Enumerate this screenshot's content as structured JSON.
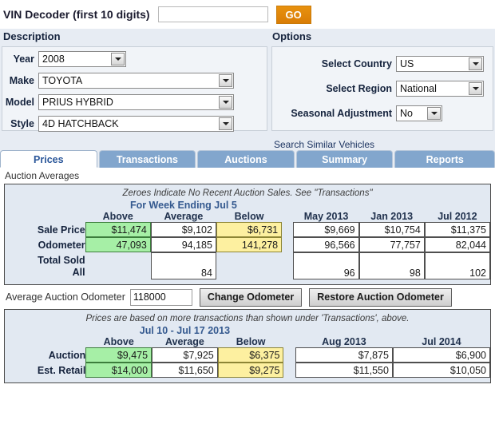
{
  "vin": {
    "label": "VIN Decoder (first 10 digits)",
    "value": "",
    "placeholder": "",
    "go_label": "GO"
  },
  "sections": {
    "description_header": "Description",
    "options_header": "Options"
  },
  "description": {
    "fields": [
      {
        "label": "Year",
        "value": "2008"
      },
      {
        "label": "Make",
        "value": "TOYOTA"
      },
      {
        "label": "Model",
        "value": "PRIUS HYBRID"
      },
      {
        "label": "Style",
        "value": "4D HATCHBACK"
      }
    ]
  },
  "options": {
    "fields": [
      {
        "label": "Select Country",
        "value": "US"
      },
      {
        "label": "Select Region",
        "value": "National"
      },
      {
        "label": "Seasonal Adjustment",
        "value": "No"
      }
    ],
    "search_similar": "Search Similar Vehicles"
  },
  "tabs": [
    {
      "label": "Prices",
      "active": true
    },
    {
      "label": "Transactions",
      "active": false
    },
    {
      "label": "Auctions",
      "active": false
    },
    {
      "label": "Summary",
      "active": false
    },
    {
      "label": "Reports",
      "active": false
    }
  ],
  "auction_averages": {
    "caption": "Auction Averages",
    "note": "Zeroes Indicate No Recent Auction Sales. See \"Transactions\"",
    "period": "For Week Ending Jul 5",
    "columns": [
      "Above",
      "Average",
      "Below"
    ],
    "history_columns": [
      "May 2013",
      "Jan 2013",
      "Jul 2012"
    ],
    "rows": [
      {
        "label": "Sale Price",
        "above": "$11,474",
        "average": "$9,102",
        "below": "$6,731",
        "history": [
          "$9,669",
          "$10,754",
          "$11,375"
        ]
      },
      {
        "label": "Odometer",
        "above": "47,093",
        "average": "94,185",
        "below": "141,278",
        "history": [
          "96,566",
          "77,757",
          "82,044"
        ]
      },
      {
        "label_line1": "Total Sold",
        "label_line2": "All",
        "above": "",
        "average": "84",
        "below": "",
        "history": [
          "96",
          "98",
          "102"
        ]
      }
    ]
  },
  "odometer": {
    "label": "Average Auction Odometer",
    "value": "118000",
    "change_label": "Change Odometer",
    "restore_label": "Restore Auction Odometer"
  },
  "prices": {
    "note": "Prices are based on more transactions than shown under 'Transactions', above.",
    "period": "Jul 10 - Jul 17 2013",
    "columns": [
      "Above",
      "Average",
      "Below"
    ],
    "history_columns": [
      "Aug 2013",
      "Jul 2014"
    ],
    "rows": [
      {
        "label": "Auction",
        "above": "$9,475",
        "average": "$7,925",
        "below": "$6,375",
        "history": [
          "$7,875",
          "$6,900"
        ]
      },
      {
        "label": "Est. Retail",
        "above": "$14,000",
        "average": "$11,650",
        "below": "$9,275",
        "history": [
          "$11,550",
          "$10,050"
        ]
      }
    ]
  },
  "colors": {
    "accent_blue": "#34598f",
    "tab_blue": "#82a6cd",
    "go_orange": "#d97d06",
    "high_green": "#a6efa6",
    "low_yellow": "#fdf0a0"
  }
}
